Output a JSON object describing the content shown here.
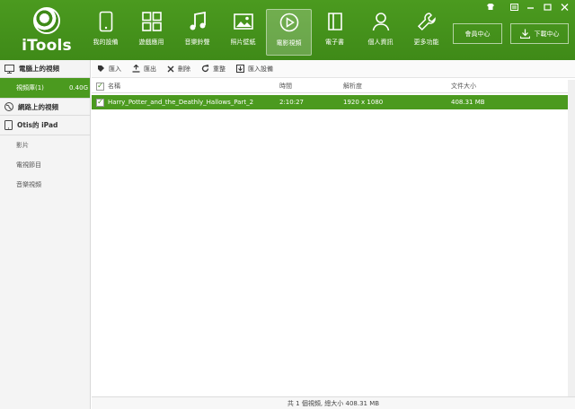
{
  "app": {
    "name": "iTools"
  },
  "nav": [
    {
      "label": "我的設備",
      "icon": "device-icon"
    },
    {
      "label": "遊戲應用",
      "icon": "apps-icon"
    },
    {
      "label": "音樂鈴聲",
      "icon": "music-icon"
    },
    {
      "label": "照片壁紙",
      "icon": "photo-icon"
    },
    {
      "label": "電影視頻",
      "icon": "video-icon",
      "active": true
    },
    {
      "label": "電子書",
      "icon": "book-icon"
    },
    {
      "label": "個人資訊",
      "icon": "person-icon"
    },
    {
      "label": "更多功能",
      "icon": "tools-icon"
    }
  ],
  "header_buttons": {
    "member": "會員中心",
    "download": "下載中心"
  },
  "sidebar": {
    "pc_section": "電腦上的視頻",
    "pc_library": "視頻庫(1)",
    "pc_library_size": "0.40G",
    "net_section": "網路上的視頻",
    "device_section": "Otis的 iPad",
    "device_items": [
      "影片",
      "電視節目",
      "音樂視頻"
    ]
  },
  "toolbar": {
    "import": "匯入",
    "export": "匯出",
    "delete": "刪除",
    "refresh": "重整",
    "import_device": "匯入設備"
  },
  "table": {
    "headers": {
      "name": "名稱",
      "time": "時間",
      "resolution": "解析度",
      "size": "文件大小"
    },
    "rows": [
      {
        "name": "Harry_Potter_and_the_Deathly_Hallows_Part_2",
        "time": "2:10:27",
        "resolution": "1920 x 1080",
        "size": "408.31 MB"
      }
    ]
  },
  "status": "共 1 個視頻, 總大小 408.31 MB",
  "colors": {
    "brand": "#4b9a1f",
    "brand_dark": "#3f8a18"
  }
}
